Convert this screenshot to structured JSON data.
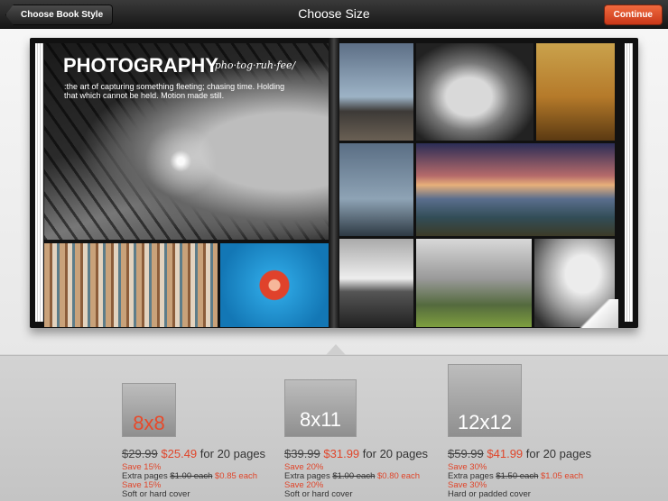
{
  "topbar": {
    "back_label": "Choose Book Style",
    "title": "Choose Size",
    "continue_label": "Continue"
  },
  "book": {
    "heading": "PHOTOGRAPHY",
    "pronunciation": "/pho·tog·ruh·fee/",
    "definition": ":the art of capturing something fleeting; chasing time. Holding that which cannot be held. Motion made still."
  },
  "options": [
    {
      "size": "8x8",
      "old_price": "$29.99",
      "new_price": "$25.49",
      "pages": "for 20 pages",
      "save": "Save 15%",
      "extra_prefix": "Extra pages",
      "extra_old": "$1.00 each",
      "extra_new": "$0.85 each",
      "save_extra": "Save 15%",
      "cover": "Soft or hard cover"
    },
    {
      "size": "8x11",
      "old_price": "$39.99",
      "new_price": "$31.99",
      "pages": "for 20 pages",
      "save": "Save 20%",
      "extra_prefix": "Extra pages",
      "extra_old": "$1.00 each",
      "extra_new": "$0.80 each",
      "save_extra": "Save 20%",
      "cover": "Soft or hard cover"
    },
    {
      "size": "12x12",
      "old_price": "$59.99",
      "new_price": "$41.99",
      "pages": "for 20 pages",
      "save": "Save 30%",
      "extra_prefix": "Extra pages",
      "extra_old": "$1.50 each",
      "extra_new": "$1.05 each",
      "save_extra": "Save 30%",
      "cover": "Hard or padded cover"
    }
  ],
  "colors": {
    "accent": "#e0452a",
    "continue": "#d9441f"
  }
}
